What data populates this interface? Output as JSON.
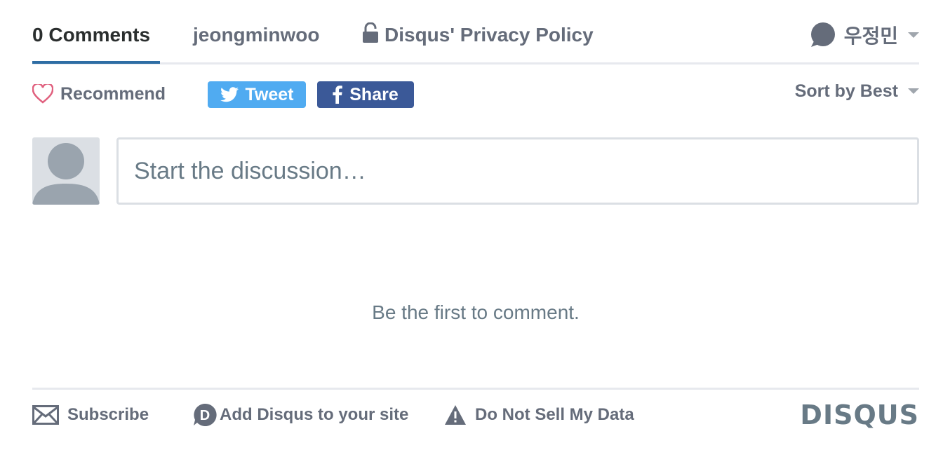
{
  "nav": {
    "comments_tab": "0 Comments",
    "community_tab": "jeongminwoo",
    "privacy_tab": "Disqus' Privacy Policy",
    "user_name": "우정민"
  },
  "actions": {
    "recommend_label": "Recommend",
    "tweet_label": "Tweet",
    "share_label": "Share",
    "sort_label": "Sort by Best"
  },
  "composer": {
    "placeholder": "Start the discussion…"
  },
  "empty_state": {
    "message": "Be the first to comment."
  },
  "footer": {
    "subscribe_label": "Subscribe",
    "add_disqus_label": "Add Disqus to your site",
    "do_not_sell_label": "Do Not Sell My Data",
    "logo_text": "DISQUS"
  },
  "colors": {
    "active_tab_underline": "#2e6da4",
    "tweet_button": "#50abf1",
    "share_button": "#3b5998",
    "recommend_heart": "#e0607e",
    "muted_text": "#656c7a"
  },
  "icons": [
    "lock-icon",
    "user-bubble-icon",
    "heart-icon",
    "twitter-bird-icon",
    "facebook-f-icon",
    "envelope-icon",
    "disqus-d-icon",
    "warning-icon"
  ]
}
